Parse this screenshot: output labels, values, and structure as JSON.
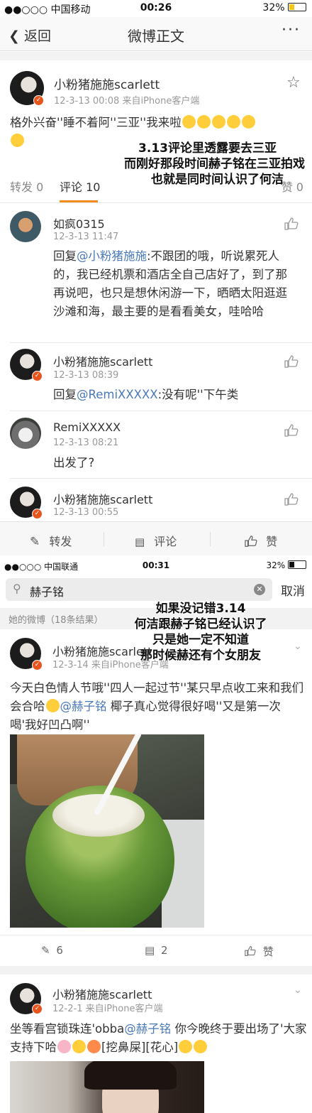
{
  "screen1": {
    "status": {
      "carrier": "●●○○○ 中国移动",
      "time": "00:26",
      "battery": "32%"
    },
    "nav": {
      "back_label": "返回",
      "title": "微博正文",
      "more": "···"
    },
    "post": {
      "username": "小粉猪施施scarlett",
      "meta": "12-3-13 00:08  来自iPhone客户端",
      "text": "格外兴奋''睡不着阿''三亚''我来啦"
    },
    "annotation": [
      "3.13评论里透露要去三亚",
      "而刚好那段时间赫子铭在三亚拍戏",
      "也就是同时间认识了何洁"
    ],
    "tabs": {
      "repost": "转发 0",
      "comment": "评论 10",
      "like": "赞 0"
    },
    "comments": [
      {
        "username": "如疯0315",
        "time": "12-3-13 11:47",
        "reply_prefix": "回复",
        "mention": "@小粉猪施施",
        "text": ":不跟团的哦，听说累死人的，我已经机票和酒店全自己店好了，到了那再说吧，也只是想休闲游一下，晒晒太阳逛逛沙滩和海，最主要的是看看美女，哇哈哈"
      },
      {
        "username": "小粉猪施施scarlett",
        "time": "12-3-13 08:39",
        "reply_prefix": "回复",
        "mention": "@RemiXXXXX",
        "text": ":没有呢''下午类"
      },
      {
        "username": "RemiXXXXX",
        "time": "12-3-13 08:21",
        "text": "出发了?"
      },
      {
        "username": "小粉猪施施scarlett",
        "time": "12-3-13 00:55"
      }
    ],
    "actions": {
      "repost": "转发",
      "comment": "评论",
      "like": "赞"
    }
  },
  "screen2": {
    "status": {
      "carrier": "●●○○○ 中国联通",
      "time": "00:31",
      "battery": "32%"
    },
    "search": {
      "query": "赫子铭",
      "cancel": "取消"
    },
    "section_label": "她的微博（18条结果）",
    "annotation": [
      "如果没记错3.14",
      "何洁跟赫子铭已经认识了",
      "只是她一定不知道",
      "那时候赫还有个女朋友"
    ],
    "posts": [
      {
        "username": "小粉猪施施scarlett",
        "meta": "12-3-14  来自iPhone客户端",
        "text_a": "今天白色情人节哦''四人一起过节''某只早点收工来和我们会合哈",
        "mention": "@赫子铭",
        "text_b": " 椰子真心觉得很好喝''又是第一次喝'我好凹凸啊''",
        "repost_count": "6",
        "comment_count": "2",
        "like_label": "赞"
      },
      {
        "username": "小粉猪施施scarlett",
        "meta": "12-2-1  来自iPhone客户端",
        "text_a": "坐等看宫锁珠连'obba",
        "mention": "@赫子铭",
        "text_b": " 你今晚终于要出场了'大家支持下哈",
        "text_c": "[挖鼻屎][花心]"
      }
    ]
  }
}
